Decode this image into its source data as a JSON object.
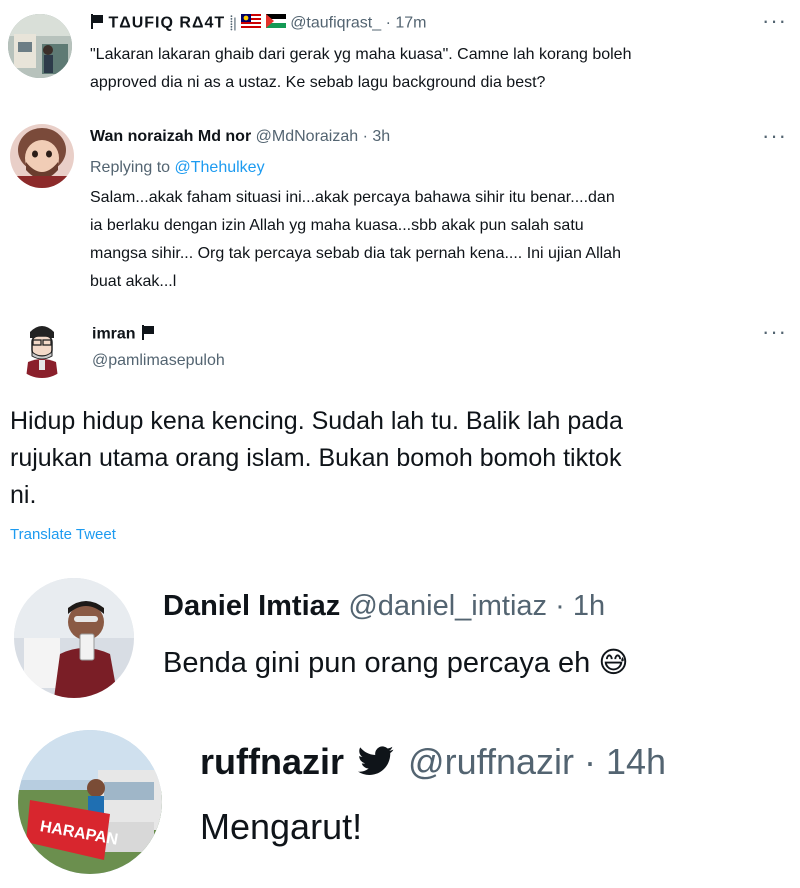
{
  "tweet1": {
    "name": "TΔUFIQ RΔ4T",
    "name_suffix": "⸽|",
    "handle": "@taufiqrast_",
    "sep": "·",
    "time": "17m",
    "text_lines": [
      "\"Lakaran lakaran ghaib dari gerak yg maha kuasa\". Camne lah korang boleh",
      "approved dia ni as a ustaz. Ke sebab lagu background dia best?"
    ],
    "more": "···"
  },
  "tweet2": {
    "name": "Wan noraizah Md nor",
    "handle": "@MdNoraizah",
    "sep": "·",
    "time": "3h",
    "reply_prefix": "Replying to",
    "reply_to": "@Thehulkey",
    "text_lines": [
      "Salam...akak faham situasi ini...akak percaya bahawa sihir itu benar....dan",
      "ia berlaku dengan izin Allah yg maha kuasa...sbb akak pun salah satu",
      "mangsa sihir... Org tak percaya sebab dia tak pernah kena.... Ini ujian Allah",
      "buat akak...l"
    ],
    "more": "···"
  },
  "tweet3": {
    "name": "imran",
    "handle": "@pamlimasepuloh",
    "text_lines": [
      "Hidup hidup kena kencing. Sudah lah tu. Balik lah pada",
      "rujukan utama orang islam. Bukan bomoh bomoh tiktok",
      "ni."
    ],
    "translate": "Translate Tweet",
    "more": "···"
  },
  "tweet4": {
    "name": "Daniel Imtiaz",
    "handle": "@daniel_imtiaz",
    "sep": "·",
    "time": "1h",
    "text": "Benda gini pun orang percaya eh",
    "emoji": "😅"
  },
  "tweet5": {
    "name": "ruffnazir",
    "handle": "@ruffnazir",
    "sep": "·",
    "time": "14h",
    "text": "Mengarut!",
    "banner_text": "HARAPAN"
  },
  "colors": {
    "text": "#0f1419",
    "muted": "#536471",
    "link": "#1d9bf0"
  },
  "icons": [
    "flag-icon",
    "malaysia-flag-icon",
    "palestine-flag-icon",
    "more-options-icon",
    "twitter-bird-icon",
    "sweat-smile-emoji"
  ]
}
